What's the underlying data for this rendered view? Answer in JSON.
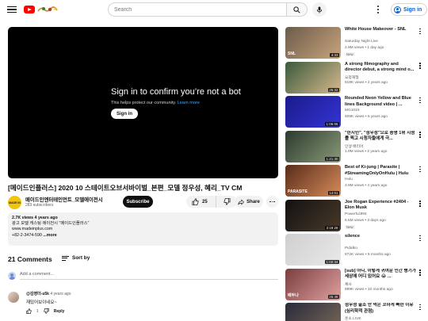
{
  "header": {
    "search_placeholder": "Search",
    "sign_in": "Sign in"
  },
  "player": {
    "title": "Sign in to confirm you’re not a bot",
    "sub_text": "This helps protect our community.",
    "learn_more": "Learn more",
    "button": "Sign in"
  },
  "video": {
    "title": "[메이드인플러스] 2020 10 스테이트오브서바이벌_본편_모델 정우성, 혜리_TV CM",
    "channel": "메이드인엔터테인먼트_모델에이전시",
    "avatar_text": "MADE IN",
    "subscribers": "283 subscribers",
    "subscribe": "Subscribe",
    "likes": "25",
    "share": "Share"
  },
  "description": {
    "stats": "2.7K views  4 years ago",
    "line1": "광고 모델 캐스팅 에이전시 \"메이드인플러스\"",
    "line2": "www.madeinplus.com",
    "line3": "+82-2-3474-590",
    "more": "...more"
  },
  "comments": {
    "count": "21 Comments",
    "sort_by": "Sort by",
    "add_placeholder": "Add a comment...",
    "first": {
      "author": "@김영더-u5k",
      "time": "4 years ago",
      "text": "재밌어보이네요~",
      "likes": "1",
      "reply": "Reply"
    }
  },
  "recommendations": [
    {
      "title": "White House Makeover - SNL",
      "channel": "Saturday Night Live",
      "views": "2.9M views • 1 day ago",
      "badge": "New",
      "duration": "4:33",
      "caption": "SNL",
      "color1": "#6b5b4b",
      "color2": "#c9a47c"
    },
    {
      "title": "A strong filmography and director debut, a strong mind o...",
      "channel": "요정재형",
      "views": "818K views • 2 years ago",
      "badge": "",
      "duration": "25:32",
      "caption": "",
      "color1": "#3a5a3c",
      "color2": "#d8b98f"
    },
    {
      "title": "Rounded Neon Yellow and Blue lines Background video | ...",
      "channel": "MG1010",
      "views": "509K views • 5 years ago",
      "badge": "",
      "duration": "1:06:05",
      "caption": "",
      "color1": "#1b1b8a",
      "color2": "#3434d6"
    },
    {
      "title": "\"한지민\", \"정우성\"으로 증명 1위 시청률 찍고 시청자들에게 극...",
      "channel": "인생 배리어",
      "views": "1.9M views • 2 years ago",
      "badge": "",
      "duration": "1:21:30",
      "caption": "",
      "color1": "#2c3a2e",
      "color2": "#8a9a78"
    },
    {
      "title": "Best of Ki-jung | Parasite | #StreamingOnlyOnHulu | Hulu",
      "channel": "Hulu",
      "views": "3.9M views • 4 years ago",
      "badge": "",
      "duration": "14:01",
      "caption": "PARASITE",
      "color1": "#5a2b1a",
      "color2": "#d48c5a"
    },
    {
      "title": "Joe Rogan Experience #2404 - Elon Musk",
      "channel": "PowerfulJRE",
      "views": "5.5M views • 3 days ago",
      "badge": "New",
      "duration": "3:18:28",
      "caption": "",
      "color1": "#111111",
      "color2": "#4a3a2a"
    },
    {
      "title": "silence",
      "channel": "Pidalko",
      "views": "872K views • 9 months ago",
      "badge": "",
      "duration": "1:02:34",
      "caption": "",
      "color1": "#cfcfcf",
      "color2": "#e9e9e9"
    },
    {
      "title": "[sub] 아니, 이렇게 귀여운 인간 병기가 세상에 어디 있어요 😂 ...",
      "channel": "채사",
      "views": "889K views • 10 months ago",
      "badge": "",
      "duration": "25:46",
      "caption": "배두나",
      "color1": "#7a3e3e",
      "color2": "#e0a0a0"
    },
    {
      "title": "정우성 출소 안 먹은 꼬하게 빠한 이유 (심리학적 관점)",
      "channel": "혼소 LIVE",
      "views": "",
      "badge": "",
      "duration": "",
      "caption": "",
      "color1": "#2a2a3a",
      "color2": "#7a6a5a"
    }
  ]
}
